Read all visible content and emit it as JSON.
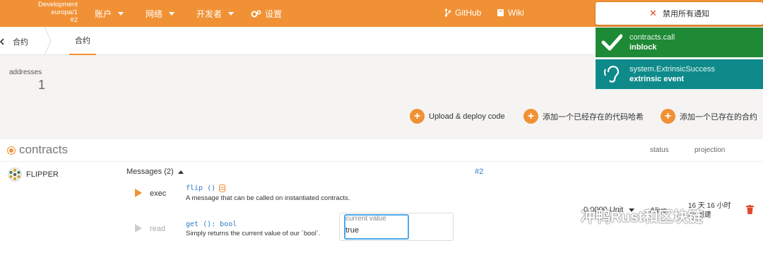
{
  "topbar": {
    "chain_line1": "Development",
    "chain_line2": "europa/1",
    "chain_line3": "#2",
    "nav": {
      "accounts": "账户",
      "network": "网络",
      "developer": "开发者",
      "settings": "设置",
      "github": "GitHub",
      "wiki": "Wiki"
    }
  },
  "tabs": {
    "section": "合约",
    "active": "合约"
  },
  "summary": {
    "addresses_label": "addresses",
    "addresses_value": "1"
  },
  "actions": {
    "upload": "Upload & deploy code",
    "add_code_hash": "添加一个已经存在的代码哈希",
    "add_contract": "添加一个已存在的合约"
  },
  "contracts": {
    "title": "contracts",
    "col_status": "status",
    "col_projection": "projection",
    "name": "FLIPPER",
    "messages_label": "Messages (2)",
    "block": "#2",
    "messages": [
      {
        "name": "exec",
        "signature": "flip ()",
        "description": "A message that can be called on instantiated contracts."
      },
      {
        "name": "read",
        "signature": "get (): bool",
        "description": "Simply returns the current value of our `bool`."
      }
    ],
    "current_value_label": "current value",
    "current_value": "true",
    "balance": "0.0000 Unit",
    "status": "Alive",
    "age_line1": "16 天 16 小时",
    "age_line2": "前 创建"
  },
  "notifications": {
    "disable_all": "禁用所有通知",
    "items": [
      {
        "title": "contracts.call",
        "subtitle": "inblock",
        "color": "#1e8a36"
      },
      {
        "title": "system.ExtrinsicSuccess",
        "subtitle": "extrinsic event",
        "color": "#0e8a8a"
      }
    ]
  },
  "watermark": "冲鸭Rust和区块链",
  "colors": {
    "accent": "#f19135",
    "link": "#2d7bc4"
  }
}
